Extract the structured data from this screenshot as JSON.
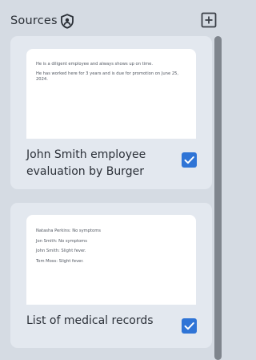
{
  "header": {
    "title": "Sources",
    "shield_icon": "shield-lock-icon",
    "add_icon": "add-box-icon"
  },
  "sources": [
    {
      "preview_lines": [
        "He is a diligent employee and always shows up on time.",
        "He has worked here for 3 years and is due for promotion on June 25, 2024."
      ],
      "title": "John Smith employee evaluation by Burger",
      "checked": true
    },
    {
      "preview_lines": [
        "Natasha Perkins: No symptoms",
        "Jon Smith: No symptoms",
        "John Smith: Slight fever.",
        "Tom Moss: Slight fever."
      ],
      "title": "List of medical records",
      "checked": true
    }
  ],
  "colors": {
    "background": "#d5dbe3",
    "card": "#e3e8ef",
    "checkbox": "#2f74d6",
    "scrollbar": "#7f858d"
  }
}
